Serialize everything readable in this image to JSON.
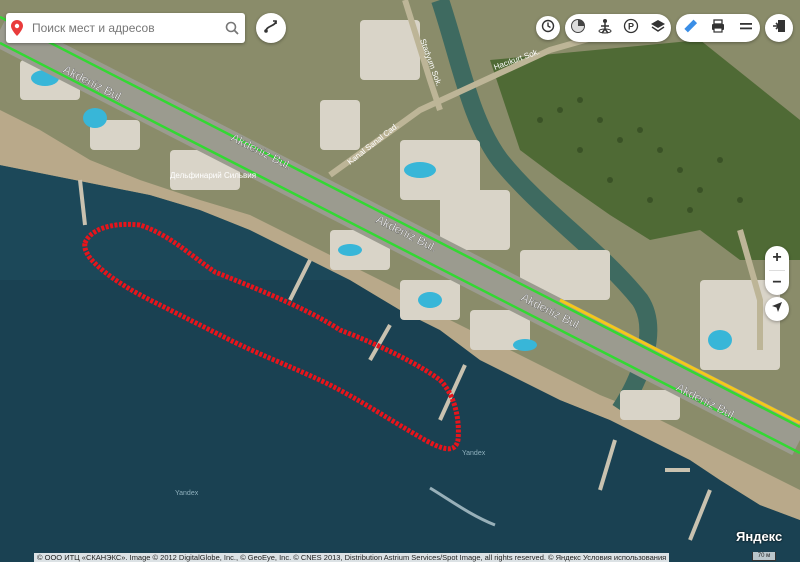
{
  "search": {
    "placeholder": "Поиск мест и адресов"
  },
  "roads": {
    "main_label": "Akdeniz Bul.",
    "side_label_1": "Stadyum Sok.",
    "side_label_2": "Hacıkurt Sok.",
    "side_label_3": "Kanal Sanal Cad."
  },
  "places": {
    "dolphinarium": "Дельфинарий Сильвия"
  },
  "watermark": "Yandex",
  "logo": "Яндекс",
  "scale": "70 м",
  "copyright": "© ООО ИТЦ «СКАНЭКС». Image © 2012 DigitalGlobe, Inc., © GeoEye, Inc. © CNES 2013, Distribution Astrium Services/Spot Image, all rights reserved. © Яндекс Условия использования",
  "colors": {
    "track": "#e8141b",
    "road_green": "#33d833",
    "road_yellow": "#f4c81a",
    "sea": "#1d4a5c"
  }
}
